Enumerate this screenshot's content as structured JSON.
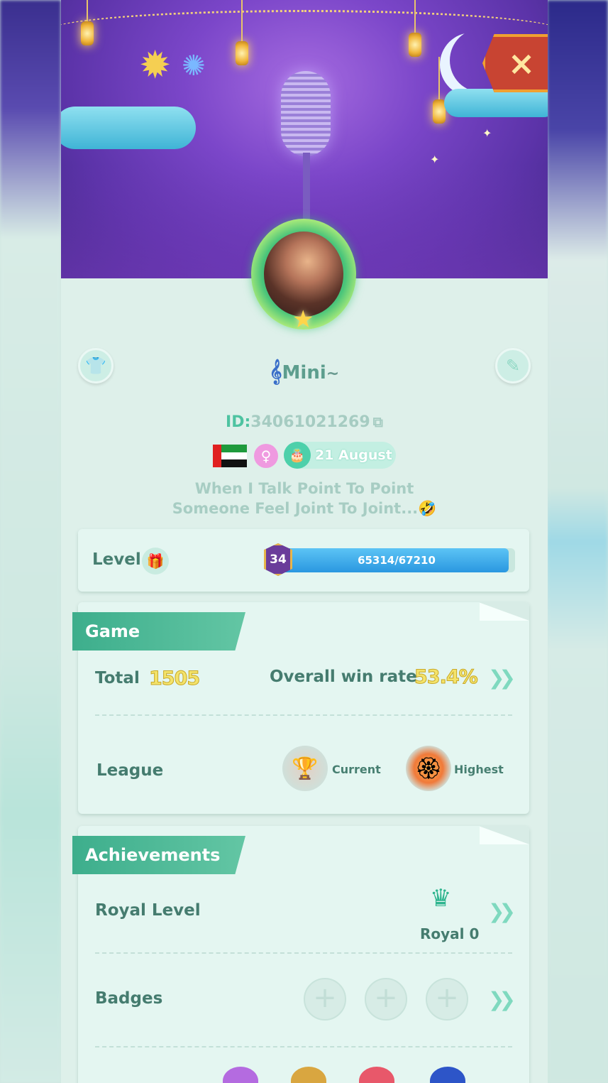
{
  "profile": {
    "name": "Mini",
    "id_label": "ID:",
    "id_value": "34061021269",
    "birthday": "21 August",
    "bio_line1": "When I Talk Point To Point",
    "bio_line2": "Someone Feel Joint To Joint...🤣",
    "gender_symbol": "♀"
  },
  "level": {
    "label": "Level",
    "badge": "34",
    "progress_text": "65314/67210",
    "progress_fraction": 0.972
  },
  "game": {
    "title": "Game",
    "total_label": "Total",
    "total_value": "1505",
    "winrate_label": "Overall win rate",
    "winrate_value": "53.4%",
    "league_label": "League",
    "current_label": "Current",
    "highest_label": "Highest"
  },
  "achievements": {
    "title": "Achievements",
    "royal_label": "Royal Level",
    "royal_value": "Royal 0",
    "badges_label": "Badges"
  },
  "icons": {
    "close": "×",
    "shirt": "👕",
    "edit": "✎",
    "copy": "⧉",
    "gift": "🎁",
    "cake": "🎂",
    "chevron": "❯❯",
    "crown": "♛",
    "plus": "+",
    "trophy_current": "🏆",
    "trophy_highest": "🏵"
  },
  "colors": {
    "accent": "#3dae8c",
    "gold": "#f3e36b",
    "progress": "#2a97e0",
    "close_button": "#c84432"
  }
}
